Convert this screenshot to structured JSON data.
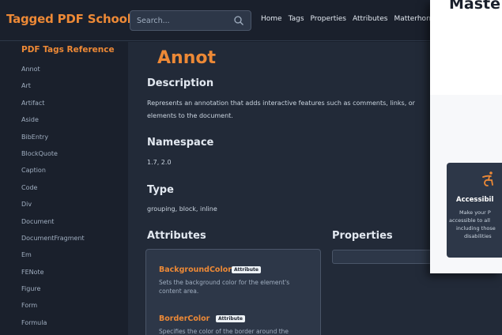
{
  "header": {
    "brand": "Tagged PDF School",
    "search_placeholder": "Search...",
    "nav": [
      "Home",
      "Tags",
      "Properties",
      "Attributes",
      "Matterhorn"
    ]
  },
  "sidebar": {
    "title": "PDF Tags Reference",
    "items": [
      "Annot",
      "Art",
      "Artifact",
      "Aside",
      "BibEntry",
      "BlockQuote",
      "Caption",
      "Code",
      "Div",
      "Document",
      "DocumentFragment",
      "Em",
      "FENote",
      "Figure",
      "Form",
      "Formula"
    ]
  },
  "main": {
    "title": "Annot",
    "description_heading": "Description",
    "description_line1": "Represents an annotation that adds interactive features such as comments, links, or",
    "description_line2": "elements to the document.",
    "namespace_heading": "Namespace",
    "namespace_value": "1.7, 2.0",
    "type_heading": "Type",
    "type_value": "grouping, block, inline",
    "attributes_heading": "Attributes",
    "properties_heading": "Properties",
    "attributes": [
      {
        "name": "BackgroundColor",
        "badge": "Attribute",
        "desc_line1": "Sets the background color for the element's",
        "desc_line2": "content area."
      },
      {
        "name": "BorderColor",
        "badge": "Attribute",
        "desc_line1": "Specifies the color of the border around the",
        "desc_line2": ""
      }
    ]
  },
  "overlay": {
    "title": "Maste",
    "card_title": "Accessibil",
    "card_lines": [
      "Make your P",
      "accessible to all",
      "including those",
      "disabilities"
    ]
  }
}
